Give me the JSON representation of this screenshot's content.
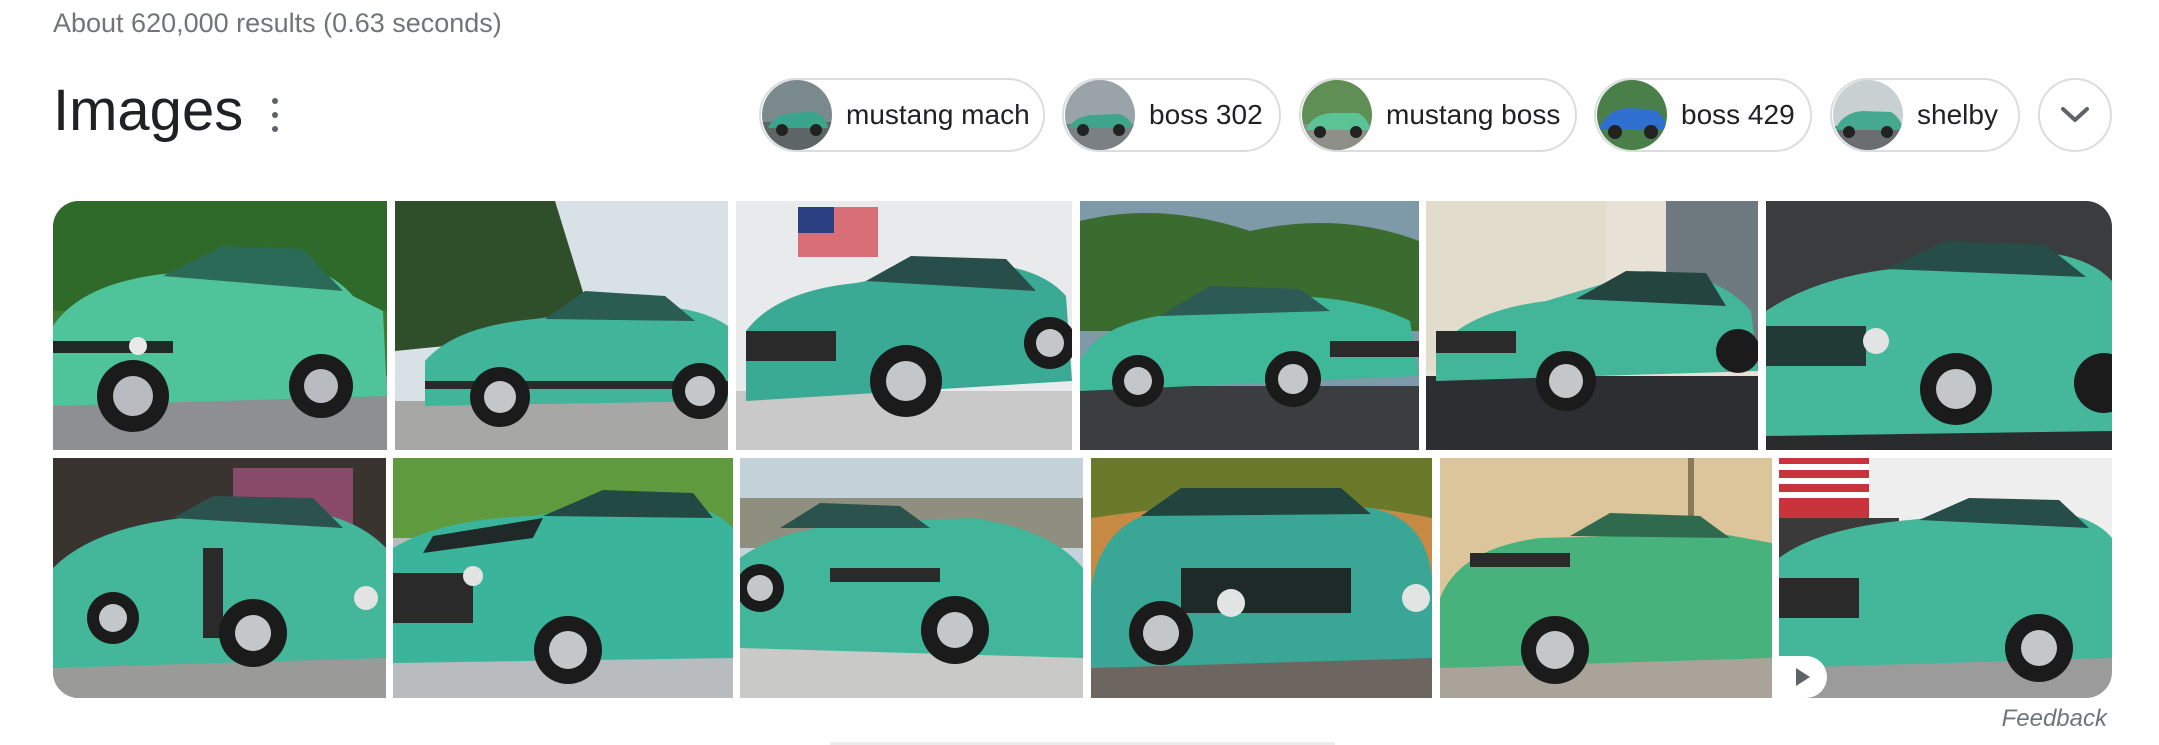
{
  "results_stats": "About 620,000 results (0.63 seconds)",
  "section_title": "Images",
  "chips": [
    {
      "label": "mustang mach",
      "thumb_bg": "#7a8a8c",
      "car": "#3aa58c"
    },
    {
      "label": "boss 302",
      "thumb_bg": "#9aa3a8",
      "car": "#3fa58a"
    },
    {
      "label": "mustang boss",
      "thumb_bg": "#5f8f55",
      "car": "#5bc496"
    },
    {
      "label": "boss 429",
      "thumb_bg": "#3d7ad6",
      "car": "#2f6fd0"
    },
    {
      "label": "shelby",
      "thumb_bg": "#c9d0d2",
      "car": "#45a990"
    }
  ],
  "icons": {
    "more": "more-vert-icon",
    "expand": "chevron-down-icon",
    "play": "play-icon"
  },
  "feedback_label": "Feedback",
  "colors": {
    "car_green": "#4fc39a",
    "car_teal": "#41b59a",
    "text_secondary": "#70757a",
    "chip_border": "#dadce0"
  }
}
